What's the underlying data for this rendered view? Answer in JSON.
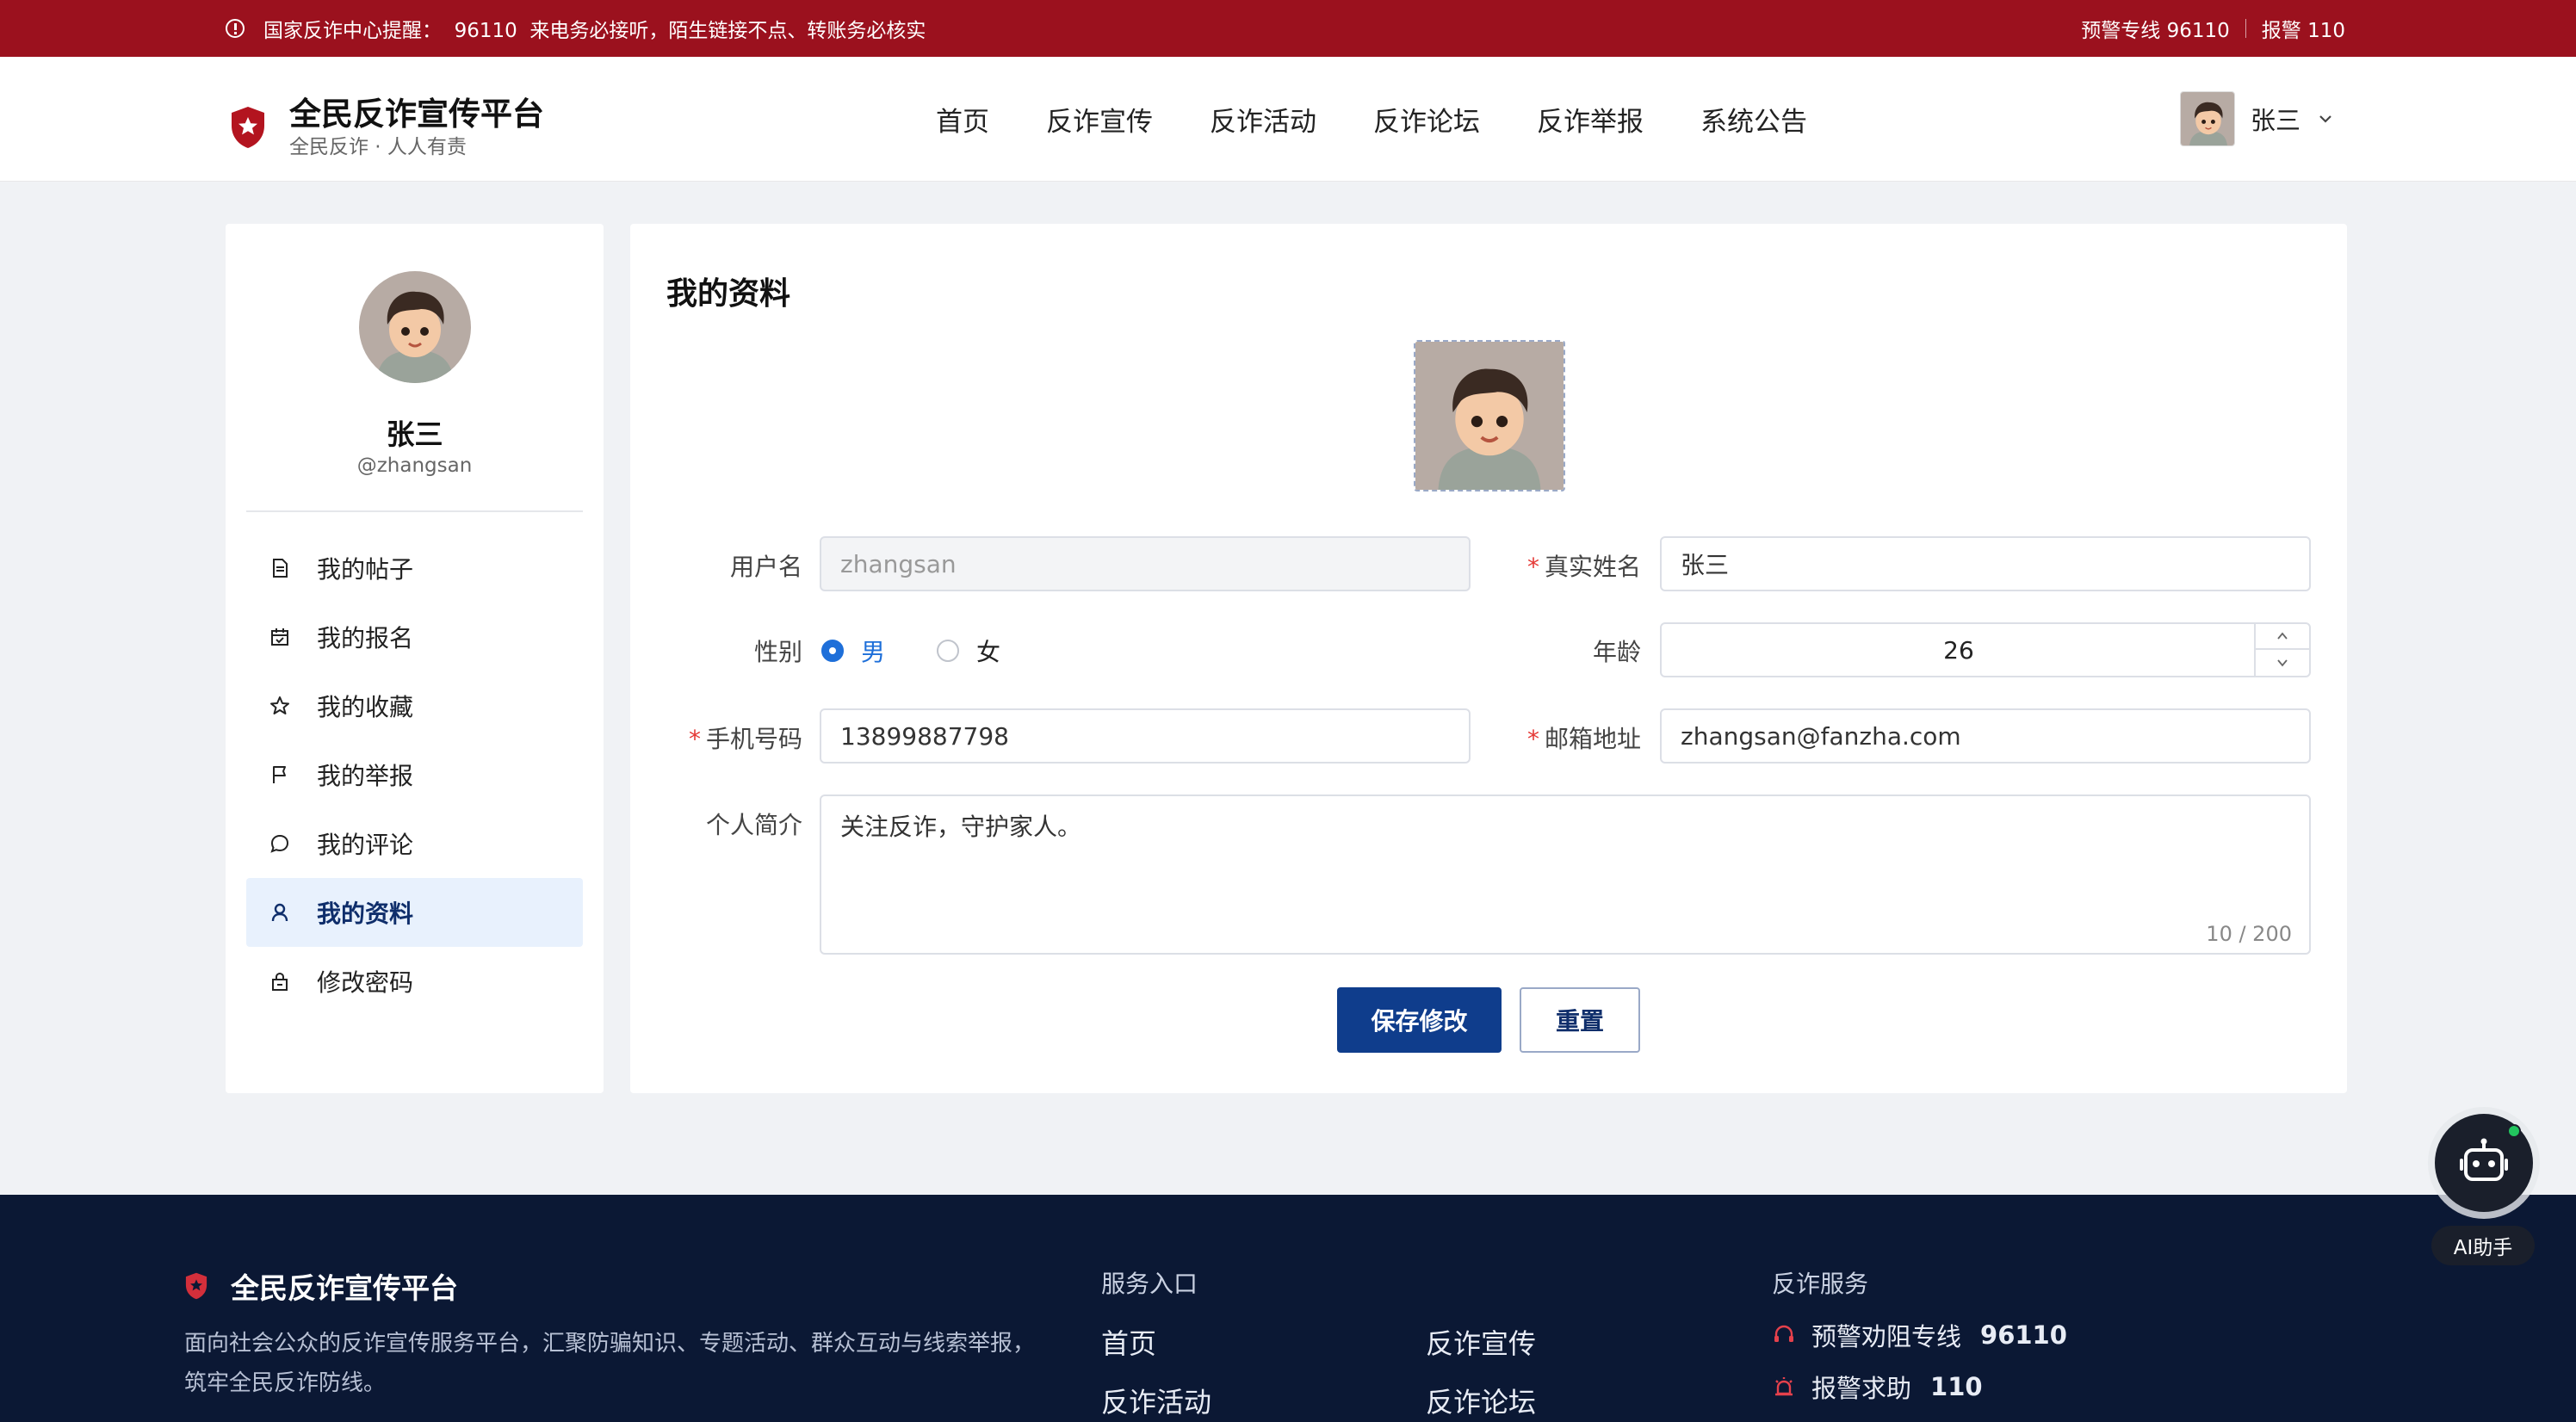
{
  "topbar": {
    "notice": "国家反诈中心提醒：  96110  来电务必接听，陌生链接不点、转账务必核实",
    "hotline": "预警专线 96110",
    "alarm": "报警 110"
  },
  "header": {
    "title": "全民反诈宣传平台",
    "subtitle": "全民反诈 · 人人有责",
    "nav": [
      "首页",
      "反诈宣传",
      "反诈活动",
      "反诈论坛",
      "反诈举报",
      "系统公告"
    ],
    "user_name": "张三"
  },
  "sidebar": {
    "name": "张三",
    "handle": "@zhangsan",
    "menu": [
      {
        "label": "我的帖子",
        "icon": "document-icon"
      },
      {
        "label": "我的报名",
        "icon": "calendar-icon"
      },
      {
        "label": "我的收藏",
        "icon": "star-icon"
      },
      {
        "label": "我的举报",
        "icon": "flag-icon"
      },
      {
        "label": "我的评论",
        "icon": "comment-icon"
      },
      {
        "label": "我的资料",
        "icon": "user-icon",
        "active": true
      },
      {
        "label": "修改密码",
        "icon": "lock-icon"
      }
    ]
  },
  "profile": {
    "heading": "我的资料",
    "username_label": "用户名",
    "username_value": "zhangsan",
    "realname_label": "真实姓名",
    "realname_value": "张三",
    "gender_label": "性别",
    "gender_options": [
      "男",
      "女"
    ],
    "gender_selected": "男",
    "age_label": "年龄",
    "age_value": "26",
    "phone_label": "手机号码",
    "phone_value": "13899887798",
    "email_label": "邮箱地址",
    "email_value": "zhangsan@fanzha.com",
    "bio_label": "个人简介",
    "bio_value": "关注反诈，守护家人。",
    "bio_count": "10 / 200",
    "save_label": "保存修改",
    "reset_label": "重置"
  },
  "footer": {
    "title": "全民反诈宣传平台",
    "description": "面向社会公众的反诈宣传服务平台，汇聚防骗知识、专题活动、群众互动与线索举报，筑牢全民反诈防线。",
    "services_heading": "服务入口",
    "links": [
      "首页",
      "反诈宣传",
      "反诈活动",
      "反诈论坛"
    ],
    "anti_heading": "反诈服务",
    "hotline_label": "预警劝阻专线",
    "hotline_number": "96110",
    "alarm_label": "报警求助",
    "alarm_number": "110"
  },
  "ai": {
    "label": "AI助手"
  },
  "colors": {
    "topbar": "#9b111e",
    "primary": "#0f3d8c",
    "footer": "#0b1834",
    "accent_blue": "#1e6fd9"
  }
}
